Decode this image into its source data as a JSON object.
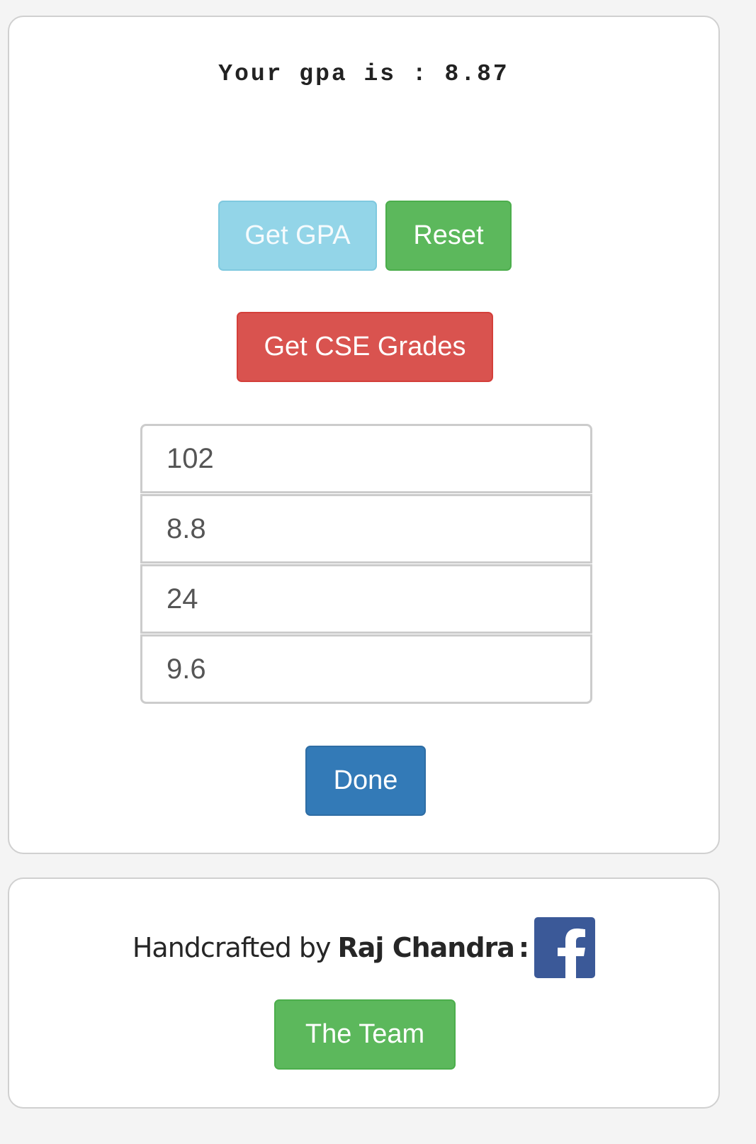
{
  "result": {
    "label": "Your gpa is : 8.87"
  },
  "actions": {
    "get_gpa_label": "Get GPA",
    "reset_label": "Reset",
    "cse_label": "Get CSE Grades",
    "done_label": "Done"
  },
  "fields": [
    {
      "value": "102"
    },
    {
      "value": "8.8"
    },
    {
      "value": "24"
    },
    {
      "value": "9.6"
    }
  ],
  "footer": {
    "prefix": "Handcrafted by",
    "author": "Raj Chandra",
    "separator": ":",
    "social_icon": "facebook-icon",
    "team_label": "The Team"
  },
  "colors": {
    "info": "#93d5e8",
    "success": "#5cb85c",
    "danger": "#d9534f",
    "primary": "#337ab7",
    "facebook": "#3b5998"
  }
}
